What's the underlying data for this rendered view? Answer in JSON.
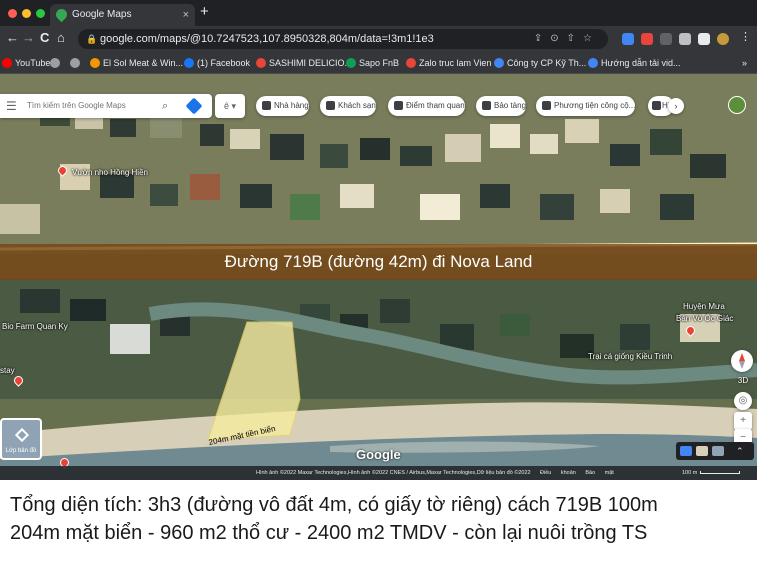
{
  "browser": {
    "tab_title": "Google Maps",
    "tab_close": "×",
    "new_tab": "+",
    "url": "google.com/maps/@10.7247523,107.8950328,804m/data=!3m1!1e3",
    "nav": {
      "back": "←",
      "forward": "→",
      "reload": "C",
      "home": "⌂"
    },
    "bookmarks": [
      {
        "label": "YouTube",
        "color": "#ff0000"
      },
      {
        "label": "",
        "color": "#9aa0a6"
      },
      {
        "label": "",
        "color": "#9aa0a6"
      },
      {
        "label": "El Sol Meat & Win...",
        "color": "#f29900"
      },
      {
        "label": "(1) Facebook",
        "color": "#1877f2"
      },
      {
        "label": "SASHIMI DELICIO...",
        "color": "#e8453c"
      },
      {
        "label": "Sapo FnB",
        "color": "#0f9d58"
      },
      {
        "label": "Zalo truc lam Vien",
        "color": "#e8453c"
      },
      {
        "label": "Công ty CP Kỹ Th...",
        "color": "#4285f4"
      },
      {
        "label": "Hướng dẫn tải vid...",
        "color": "#4285f4"
      }
    ],
    "bookmarks_more": "»"
  },
  "map": {
    "search_placeholder": "Tìm kiếm trên Google Maps",
    "translate_label": "ê",
    "chips": [
      {
        "label": "Nhà hàng"
      },
      {
        "label": "Khách sạn"
      },
      {
        "label": "Điểm tham quan"
      },
      {
        "label": "Bảo tàng"
      },
      {
        "label": "Phương tiện công cộ..."
      },
      {
        "label": "Hi"
      }
    ],
    "chip_next": "›",
    "place_labels": {
      "vuon_nho": "Vườn nho Hồng Hiền",
      "bio_farm": "Bio Farm Quan Ky",
      "huyen_mua": "Huyện Mưa",
      "ban_vo": "Bán Vỏ Ốc Giác",
      "trai_ca": "Trại cá giống Kiều Trinh",
      "stay": "stay"
    },
    "banner_text": "Đường 719B (đường 42m) đi Nova Land",
    "plot_label": "204m mặt tiền biển",
    "layers_label": "Lớp bản đồ",
    "google_logo": "Google",
    "btn_3d": "3D",
    "zoom_in": "+",
    "zoom_out": "−",
    "attribution": "Hình ảnh ©2022 Maxar Technologies,Hình ảnh ©2022 CNES / Airbus,Maxar Technologies,Dữ liệu bản đồ ©2022",
    "attribution_links": "Điều khoản   Bảo mật",
    "scale_label": "100 m"
  },
  "caption": {
    "line1": "Tổng diện tích: 3h3 (đường vô đất 4m, có giấy tờ riêng) cách 719B 100m",
    "line2": "204m mặt biển - 960 m2 thổ cư - 2400 m2 TMDV - còn lại nuôi trồng TS"
  },
  "colors": {
    "chrome_dark": "#202124",
    "chrome_mid": "#35363a",
    "banner": "#78461a",
    "plot_highlight": "#f5eca0",
    "road": "#fff4c4"
  }
}
